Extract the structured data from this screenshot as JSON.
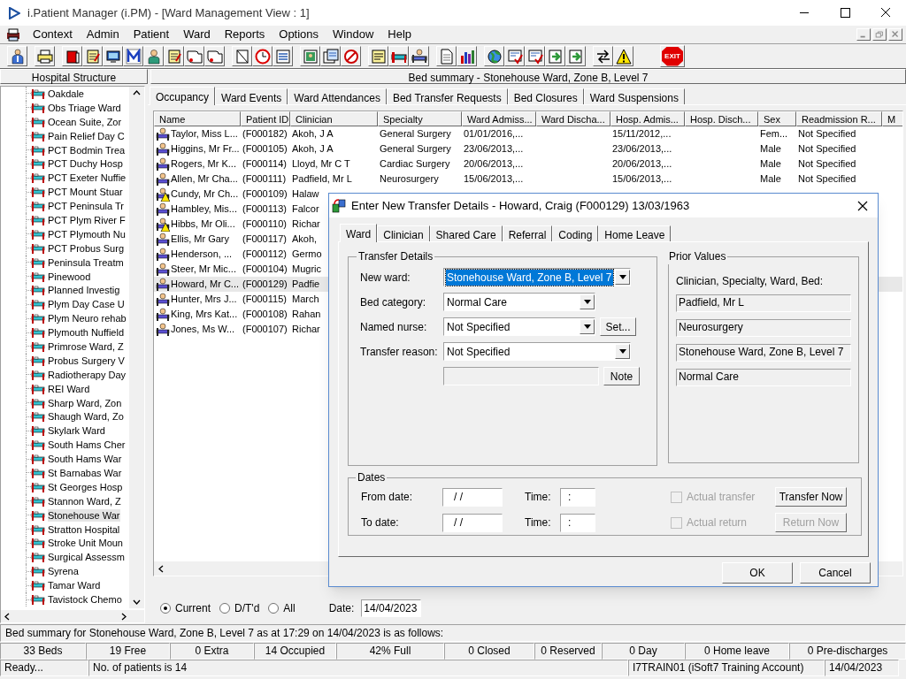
{
  "window": {
    "title": "i.Patient Manager (i.PM) - [Ward Management View : 1]"
  },
  "menu": [
    "Context",
    "Admin",
    "Patient",
    "Ward",
    "Reports",
    "Options",
    "Window",
    "Help"
  ],
  "toolbar": {
    "exit_label": "EXIT"
  },
  "tree": {
    "title": "Hospital Structure",
    "items": [
      {
        "label": "Oakdale",
        "selected": false
      },
      {
        "label": "Obs Triage Ward",
        "selected": false
      },
      {
        "label": "Ocean Suite, Zor",
        "selected": false
      },
      {
        "label": "Pain Relief Day C",
        "selected": false
      },
      {
        "label": "PCT Bodmin Trea",
        "selected": false
      },
      {
        "label": "PCT Duchy Hosp",
        "selected": false
      },
      {
        "label": "PCT Exeter Nuffie",
        "selected": false
      },
      {
        "label": "PCT Mount Stuar",
        "selected": false
      },
      {
        "label": "PCT Peninsula Tr",
        "selected": false
      },
      {
        "label": "PCT Plym River F",
        "selected": false
      },
      {
        "label": "PCT Plymouth Nu",
        "selected": false
      },
      {
        "label": "PCT Probus Surg",
        "selected": false
      },
      {
        "label": "Peninsula Treatm",
        "selected": false
      },
      {
        "label": "Pinewood",
        "selected": false
      },
      {
        "label": "Planned Investig",
        "selected": false
      },
      {
        "label": "Plym Day Case U",
        "selected": false
      },
      {
        "label": "Plym Neuro rehab",
        "selected": false
      },
      {
        "label": "Plymouth Nuffield",
        "selected": false
      },
      {
        "label": "Primrose Ward, Z",
        "selected": false
      },
      {
        "label": "Probus Surgery V",
        "selected": false
      },
      {
        "label": "Radiotherapy Day",
        "selected": false
      },
      {
        "label": "REI Ward",
        "selected": false
      },
      {
        "label": "Sharp Ward, Zon",
        "selected": false
      },
      {
        "label": "Shaugh Ward, Zo",
        "selected": false
      },
      {
        "label": "Skylark Ward",
        "selected": false
      },
      {
        "label": "South Hams Cher",
        "selected": false
      },
      {
        "label": "South Hams War",
        "selected": false
      },
      {
        "label": "St Barnabas War",
        "selected": false
      },
      {
        "label": "St Georges Hosp",
        "selected": false
      },
      {
        "label": "Stannon Ward, Z",
        "selected": false
      },
      {
        "label": "Stonehouse War",
        "selected": true
      },
      {
        "label": "Stratton Hospital",
        "selected": false
      },
      {
        "label": "Stroke Unit Moun",
        "selected": false
      },
      {
        "label": "Surgical Assessm",
        "selected": false
      },
      {
        "label": "Syrena",
        "selected": false
      },
      {
        "label": "Tamar Ward",
        "selected": false
      },
      {
        "label": "Tavistock Chemo",
        "selected": false
      }
    ]
  },
  "summary_title": "Bed summary - Stonehouse Ward, Zone B, Level 7",
  "tabs": [
    {
      "label": "Occupancy",
      "selected": true
    },
    {
      "label": "Ward Events",
      "selected": false
    },
    {
      "label": "Ward Attendances",
      "selected": false
    },
    {
      "label": "Bed Transfer Requests",
      "selected": false
    },
    {
      "label": "Bed Closures",
      "selected": false
    },
    {
      "label": "Ward Suspensions",
      "selected": false
    }
  ],
  "table": {
    "columns": [
      "Name",
      "Patient ID",
      "Clinician",
      "Specialty",
      "Ward Admiss...",
      "Ward Discha...",
      "Hosp. Admis...",
      "Hosp. Disch...",
      "Sex",
      "Readmission R...",
      "M"
    ],
    "rows": [
      {
        "alert": false,
        "selected": false,
        "cells": [
          "Taylor, Miss L...",
          "(F000182)",
          "Akoh, J A",
          "General Surgery",
          "01/01/2016,...",
          "",
          "15/11/2012,...",
          "",
          "Fem...",
          "Not Specified"
        ]
      },
      {
        "alert": false,
        "selected": false,
        "cells": [
          "Higgins, Mr Fr...",
          "(F000105)",
          "Akoh, J A",
          "General Surgery",
          "23/06/2013,...",
          "",
          "23/06/2013,...",
          "",
          "Male",
          "Not Specified"
        ]
      },
      {
        "alert": false,
        "selected": false,
        "cells": [
          "Rogers, Mr K...",
          "(F000114)",
          "Lloyd, Mr C T",
          "Cardiac Surgery",
          "20/06/2013,...",
          "",
          "20/06/2013,...",
          "",
          "Male",
          "Not Specified"
        ]
      },
      {
        "alert": false,
        "selected": false,
        "cells": [
          "Allen, Mr Cha...",
          "(F000111)",
          "Padfield, Mr L",
          "Neurosurgery",
          "15/06/2013,...",
          "",
          "15/06/2013,...",
          "",
          "Male",
          "Not Specified"
        ]
      },
      {
        "alert": true,
        "selected": false,
        "cells": [
          "Cundy, Mr Ch...",
          "(F000109)",
          "Halaw"
        ]
      },
      {
        "alert": false,
        "selected": false,
        "cells": [
          "Hambley, Mis...",
          "(F000113)",
          "Falcor"
        ]
      },
      {
        "alert": true,
        "selected": false,
        "cells": [
          "Hibbs, Mr Oli...",
          "(F000110)",
          "Richar"
        ]
      },
      {
        "alert": false,
        "selected": false,
        "cells": [
          "Ellis, Mr Gary",
          "(F000117)",
          "Akoh,"
        ]
      },
      {
        "alert": false,
        "selected": false,
        "cells": [
          "Henderson, ...",
          "(F000112)",
          "Germo"
        ]
      },
      {
        "alert": false,
        "selected": false,
        "cells": [
          "Steer, Mr Mic...",
          "(F000104)",
          "Mugric"
        ]
      },
      {
        "alert": false,
        "selected": true,
        "cells": [
          "Howard, Mr C...",
          "(F000129)",
          "Padfie"
        ]
      },
      {
        "alert": false,
        "selected": false,
        "cells": [
          "Hunter, Mrs J...",
          "(F000115)",
          "March"
        ]
      },
      {
        "alert": false,
        "selected": false,
        "cells": [
          "King, Mrs Kat...",
          "(F000108)",
          "Rahan"
        ]
      },
      {
        "alert": false,
        "selected": false,
        "cells": [
          "Jones, Ms W...",
          "(F000107)",
          "Richar"
        ]
      }
    ]
  },
  "filter": {
    "options": [
      {
        "label": "Current",
        "selected": true
      },
      {
        "label": "D/T'd",
        "selected": false
      },
      {
        "label": "All",
        "selected": false
      }
    ],
    "date_label": "Date:",
    "date": "14/04/2023"
  },
  "status_line": "Bed summary for Stonehouse Ward, Zone B, Level 7 as at 17:29 on 14/04/2023 is as follows:",
  "counts": [
    "33 Beds",
    "19 Free",
    "0 Extra",
    "14 Occupied",
    "42% Full",
    "0 Closed",
    "0 Reserved",
    "0 Day",
    "0 Home leave",
    "0 Pre-discharges"
  ],
  "status_bar": [
    "Ready...",
    "No. of patients is 14",
    "I7TRAIN01 (iSoft7 Training Account)",
    "14/04/2023"
  ],
  "dialog": {
    "title": "Enter New Transfer Details - Howard, Craig (F000129) 13/03/1963",
    "tabs": [
      {
        "label": "Ward",
        "selected": true
      },
      {
        "label": "Clinician",
        "selected": false
      },
      {
        "label": "Shared Care",
        "selected": false
      },
      {
        "label": "Referral",
        "selected": false
      },
      {
        "label": "Coding",
        "selected": false
      },
      {
        "label": "Home Leave",
        "selected": false
      }
    ],
    "transfer_details": {
      "title": "Transfer Details",
      "fields": [
        {
          "kind": "combo",
          "label": "New ward:",
          "value": "Stonehouse Ward, Zone B, Level 7",
          "focused": true
        },
        {
          "kind": "combo",
          "label": "Bed category:",
          "value": "Normal Care",
          "focused": false
        },
        {
          "kind": "combo",
          "label": "Named nurse:",
          "value": "Not Specified",
          "focused": false,
          "button": "Set..."
        },
        {
          "kind": "combo",
          "label": "Transfer reason:",
          "value": "Not Specified",
          "focused": false
        },
        {
          "kind": "note",
          "button": "Note"
        }
      ]
    },
    "prior_values": {
      "title": "Prior Values",
      "caption": "Clinician, Specialty, Ward, Bed:",
      "values": [
        "Padfield, Mr L",
        "Neurosurgery",
        "Stonehouse Ward, Zone B, Level 7",
        "Normal Care"
      ]
    },
    "dates": {
      "title": "Dates",
      "rows": [
        {
          "label": "From date:",
          "value": "/ /",
          "time_label": "Time:",
          "time": ":",
          "check": {
            "label": "Actual transfer",
            "checked": false,
            "disabled": true
          },
          "button": {
            "label": "Transfer Now",
            "disabled": false
          }
        },
        {
          "label": "To date:",
          "value": "/ /",
          "time_label": "Time:",
          "time": ":",
          "check": {
            "label": "Actual return",
            "checked": false,
            "disabled": true
          },
          "button": {
            "label": "Return Now",
            "disabled": true
          }
        }
      ]
    },
    "buttons": [
      "OK",
      "Cancel"
    ]
  }
}
